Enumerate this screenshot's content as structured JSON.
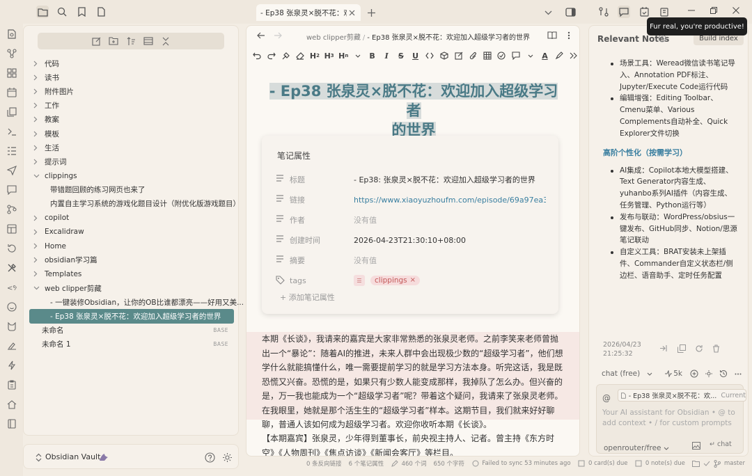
{
  "tab": {
    "title": "- Ep38 张泉灵×脱不花：欢..."
  },
  "tooltip": "Fur real, you're productive!",
  "explorer": {
    "items": [
      {
        "label": "代码",
        "kind": "folder",
        "expanded": false
      },
      {
        "label": "读书",
        "kind": "folder",
        "expanded": false
      },
      {
        "label": "附件图片",
        "kind": "folder",
        "expanded": false
      },
      {
        "label": "工作",
        "kind": "folder",
        "expanded": false
      },
      {
        "label": "教案",
        "kind": "folder",
        "expanded": false
      },
      {
        "label": "模板",
        "kind": "folder",
        "expanded": false
      },
      {
        "label": "生活",
        "kind": "folder",
        "expanded": false
      },
      {
        "label": "提示词",
        "kind": "folder",
        "expanded": false
      },
      {
        "label": "clippings",
        "kind": "folder",
        "expanded": true
      },
      {
        "label": "带错题回顾的练习网页也来了",
        "kind": "child"
      },
      {
        "label": "内置自主学习系统的游戏化题目设计（附优化版游戏题目）",
        "kind": "child"
      },
      {
        "label": "copilot",
        "kind": "folder",
        "expanded": false
      },
      {
        "label": "Excalidraw",
        "kind": "folder",
        "expanded": false
      },
      {
        "label": "Home",
        "kind": "folder",
        "expanded": false
      },
      {
        "label": "obsidian学习篇",
        "kind": "folder",
        "expanded": false
      },
      {
        "label": "Templates",
        "kind": "folder",
        "expanded": false
      },
      {
        "label": "web clipper剪藏",
        "kind": "folder",
        "expanded": true
      },
      {
        "label": "- 一键装修Obsidian，让你的OB比谁都漂亮——好用又美...",
        "kind": "child"
      },
      {
        "label": "- Ep38 张泉灵×脱不花：欢迎加入超级学习者的世界",
        "kind": "child",
        "active": true
      },
      {
        "label": "未命名",
        "kind": "file",
        "badge": "BASE"
      },
      {
        "label": "未命名 1",
        "kind": "file",
        "badge": "BASE"
      }
    ]
  },
  "vault": {
    "name": "Obsidian Vault"
  },
  "editor": {
    "breadcrumb": {
      "folder": "web clipper剪藏",
      "sep": "/",
      "current": "- Ep38 张泉灵×脱不花：欢迎加入超级学习者的世界"
    },
    "toolbar_text": {
      "h2": "H",
      "h3": "H",
      "hn": "H",
      "h2_sub": "2",
      "h3_sub": "3",
      "hn_sub": "n",
      "bold": "B",
      "italic": "I",
      "strike": "S",
      "underline": "U",
      "color_a": "A"
    },
    "title_line1": "- Ep38 张泉灵×脱不花：欢迎加入超级学习者",
    "title_line2": "的世界",
    "properties": {
      "heading": "笔记属性",
      "rows": [
        {
          "key": "标题",
          "value": "- Ep38: 张泉灵×脱不花：欢迎加入超级学习者的世界",
          "type": "text"
        },
        {
          "key": "链接",
          "value": "https://www.xiaoyuzhoufm.com/episode/69a97ea35b2",
          "type": "link"
        },
        {
          "key": "作者",
          "value": "没有值",
          "type": "empty"
        },
        {
          "key": "创建时间",
          "value": "2026-04-23T21:30:10+08:00",
          "type": "text"
        },
        {
          "key": "摘要",
          "value": "没有值",
          "type": "empty"
        },
        {
          "key": "tags",
          "value": "clippings",
          "type": "tag"
        }
      ],
      "add_label": "添加笔记属性"
    },
    "body_paragraph_1": "本期《长谈》，我请来的嘉宾是大家非常熟悉的张泉灵老师。之前李笑来老师曾抛出一个“暴论”：随着AI的推进，未来人群中会出现极少数的“超级学习者”，他们想学什么就能搞懂什么，唯一需要提前学习的就是学习方法本身。听完这话，我是既恐慌又兴奋。恐慌的是，如果只有少数人能变成那样，我掉队了怎么办。但兴奋的是，万一我也能成为一个“超级学习者”呢？带着这个疑问，我请来了张泉灵老师。在我眼里，她就是那个活生生的“超级学习者”样本。这期节目，我们就来好好聊聊，普通人该如何成为超级学习者。欢迎你收听本期《长谈》。",
    "body_paragraph_2": "【本期嘉宾】张泉灵，少年得到董事长，前央视主持人、记者。曾主持《东方时空》《人物周刊》《焦点访谈》《新闻会客厅》等栏目。"
  },
  "right_panel": {
    "title": "Relevant Notes",
    "build_button": "Build index",
    "list_top": [
      "场景工具：Weread微信读书笔记导入、Annotation PDF标注、Jupyter/Execute Code运行代码",
      "编辑增强：Editing Toolbar、Cmenu菜单、Various Complements自动补全、Quick Explorer文件切换"
    ],
    "section_heading": "高阶个性化（按需学习）",
    "list_bottom": [
      "AI集成：Copilot本地大模型搭建、Text Generator内容生成、yuhanbo系列AI插件（内容生成、任务管理、Python运行等）",
      "发布与联动：WordPress/obsius一键发布、GitHub同步、Notion/思源笔记联动",
      "自定义工具：BRAT安装未上架插件、Commander自定义状态栏/侧边栏、语音助手、定时任务配置"
    ],
    "date": "2026/04/23",
    "time": "21:25:32",
    "chat_model": "chat (free)",
    "tokens": "5k",
    "context_note": "- Ep38 张泉灵×脱不花：欢...",
    "context_current": "Current",
    "at_sign": "@",
    "placeholder": "Your AI assistant for Obsidian • @ to add context • / for custom prompts",
    "provider": "openrouter/free",
    "send_label": "chat"
  },
  "statusbar": {
    "backlinks": "0 条反向链接",
    "props": "6 个笔记属性",
    "words": "460 个词",
    "chars": "650 个字符",
    "sync": "Failed to sync 53 minutes ago",
    "cards": "0 card(s) due",
    "notes": "0 note(s) due",
    "branch": "master"
  }
}
